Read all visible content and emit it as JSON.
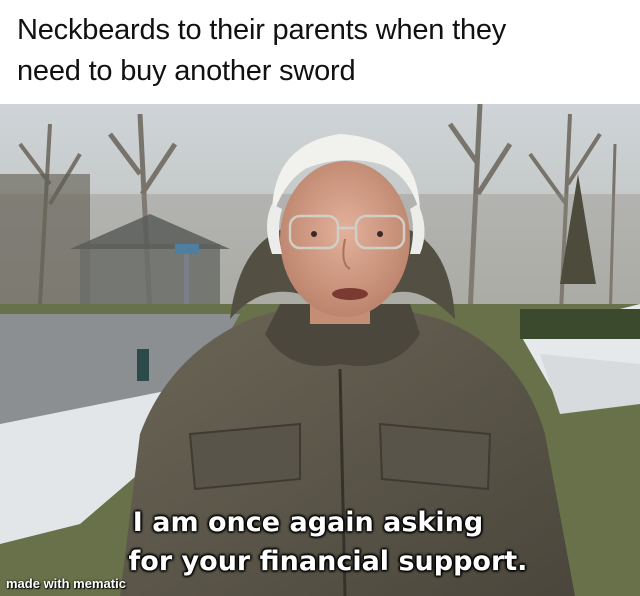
{
  "caption": {
    "line1": "Neckbeards to their parents when they",
    "line2": "need to buy another sword"
  },
  "overlay": {
    "line1": "I am once again asking",
    "line2": "for your financial support."
  },
  "watermark": "made with mematic",
  "colors": {
    "sky": "#d9dde0",
    "snow": "#e6e9ec",
    "grass": "#5c6b3c",
    "road": "#8c8f92",
    "jacket": "#5e5a4d",
    "jacket_dark": "#3d3a31",
    "skin": "#d9a58f",
    "hair": "#f2f2f0"
  }
}
